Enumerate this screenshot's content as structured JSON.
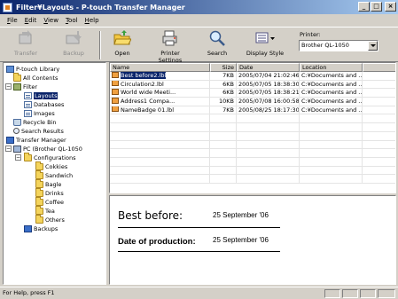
{
  "window": {
    "title": "Filter¥Layouts - P-touch Transfer Manager",
    "minimize": "_",
    "maximize": "□",
    "close": "×"
  },
  "menu": [
    "File",
    "Edit",
    "View",
    "Tool",
    "Help"
  ],
  "toolbar": {
    "transfer": "Transfer",
    "backup": "Backup",
    "open": "Open",
    "printer_settings": "Printer Settings",
    "search": "Search",
    "display_style": "Display Style",
    "printer_label": "Printer:",
    "printer_value": "Brother QL-1050"
  },
  "tree": {
    "library": "P-touch Library",
    "all_contents": "All Contents",
    "filter": "Filter",
    "layouts": "Layouts",
    "databases": "Databases",
    "images": "Images",
    "recycle_bin": "Recycle Bin",
    "search_results": "Search Results",
    "transfer_manager": "Transfer Manager",
    "pc": "PC (Brother QL-1050",
    "configurations": "Configurations",
    "cookies": "Cokkies",
    "sandwich": "Sandwich",
    "bagle": "Bagle",
    "drinks": "Drinks",
    "coffee": "Coffee",
    "tea": "Tea",
    "others": "Others",
    "backups": "Backups"
  },
  "filelist": {
    "columns": [
      "Name",
      "Size",
      "Date",
      "Location"
    ],
    "rows": [
      {
        "name": "Best before2.lbl",
        "size": "7KB",
        "date": "2005/07/04 21:02:46",
        "location": "C:¥Documents and ..."
      },
      {
        "name": "Circulation2.lbl",
        "size": "6KB",
        "date": "2005/07/05 18:38:30",
        "location": "C:¥Documents and ..."
      },
      {
        "name": "World wide Meeti...",
        "size": "6KB",
        "date": "2005/07/05 18:38:21",
        "location": "C:¥Documents and ..."
      },
      {
        "name": "Address1 Compa...",
        "size": "10KB",
        "date": "2005/07/08 16:00:58",
        "location": "C:¥Documents and ..."
      },
      {
        "name": "NameBadge 01.lbl",
        "size": "7KB",
        "date": "2005/08/25 18:17:30",
        "location": "C:¥Documents and ..."
      }
    ]
  },
  "preview": {
    "label1": "Best before:",
    "value1": "25 September '06",
    "label2": "Date of production:",
    "value2": "25 September '06"
  },
  "status": {
    "text": "For Help, press F1"
  }
}
